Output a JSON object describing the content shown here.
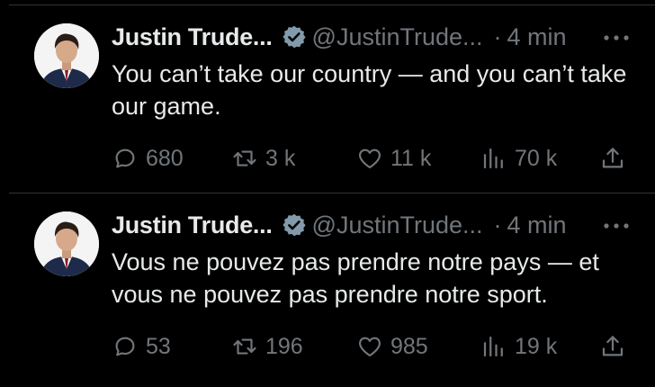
{
  "colors": {
    "background": "#000000",
    "primary_text": "#e7e9ea",
    "secondary_text": "#71767b",
    "divider": "#2f3336",
    "verified_badge": "#829aab"
  },
  "icons": {
    "reply": "speech-bubble-icon",
    "retweet": "retweet-icon",
    "like": "heart-icon",
    "views": "bar-chart-icon",
    "share": "share-upload-icon",
    "more": "more-dots-icon",
    "verified": "verified-badge-icon"
  },
  "tweets": [
    {
      "author_name": "Justin Trude...",
      "handle": "@JustinTrude...",
      "separator": "·",
      "time": "4 min",
      "text": "You can’t take our country — and you can’t take our game.",
      "replies": "680",
      "retweets": "3 k",
      "likes": "11 k",
      "views": "70 k"
    },
    {
      "author_name": "Justin Trude...",
      "handle": "@JustinTrude...",
      "separator": "·",
      "time": "4 min",
      "text": "Vous ne pouvez pas prendre notre pays — et vous ne pouvez pas prendre notre sport.",
      "replies": "53",
      "retweets": "196",
      "likes": "985",
      "views": "19 k"
    }
  ]
}
